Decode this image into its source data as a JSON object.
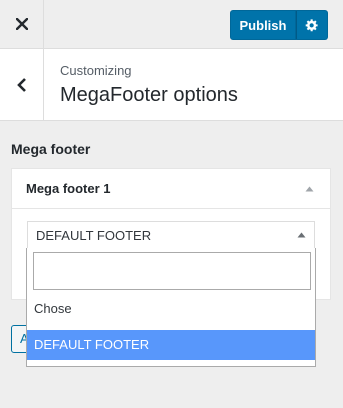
{
  "header": {
    "close_icon": "close-icon",
    "publish_label": "Publish",
    "gear_icon": "gear-icon"
  },
  "section": {
    "back_icon": "chevron-left-icon",
    "breadcrumb": "Customizing",
    "title": "MegaFooter options"
  },
  "control": {
    "label": "Mega footer"
  },
  "widget": {
    "title": "Mega footer 1",
    "toggle_icon": "triangle-up-icon",
    "select": {
      "value": "DEFAULT FOOTER",
      "arrow_icon": "triangle-up-icon"
    }
  },
  "partial_button": {
    "label": "A"
  },
  "dropdown": {
    "search_value": "",
    "options": [
      {
        "label": "Chose",
        "selected": false
      },
      {
        "label": "DEFAULT FOOTER",
        "selected": true
      }
    ],
    "highlight_color": "#5897fb"
  },
  "colors": {
    "accent": "#0073aa",
    "background": "#eeeeee"
  }
}
